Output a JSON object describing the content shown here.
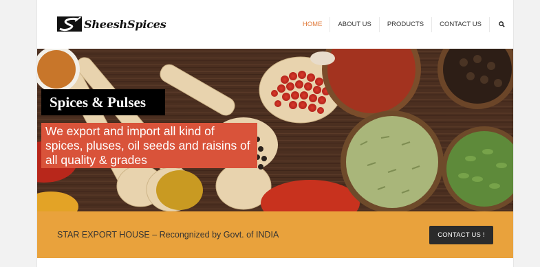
{
  "brand": {
    "name": "SheeshSpices",
    "logo_icon": "s-swoosh-logo-icon"
  },
  "nav": {
    "items": [
      {
        "label": "HOME",
        "active": true
      },
      {
        "label": "ABOUT US",
        "active": false
      },
      {
        "label": "PRODUCTS",
        "active": false
      },
      {
        "label": "CONTACT US",
        "active": false
      }
    ],
    "search_icon": "search-icon"
  },
  "hero": {
    "title": "Spices & Pulses",
    "subtitle": "We export and import all kind of spices, pluses, oil seeds and raisins of all quality & grades"
  },
  "banner": {
    "text": "STAR EXPORT HOUSE – Recongnized by Govt. of INDIA",
    "button_label": "CONTACT US !"
  },
  "colors": {
    "accent": "#e07a3a",
    "banner": "#e9a23c",
    "hero_sub_bg": "#d9533a",
    "button_bg": "#2b2b2b"
  }
}
